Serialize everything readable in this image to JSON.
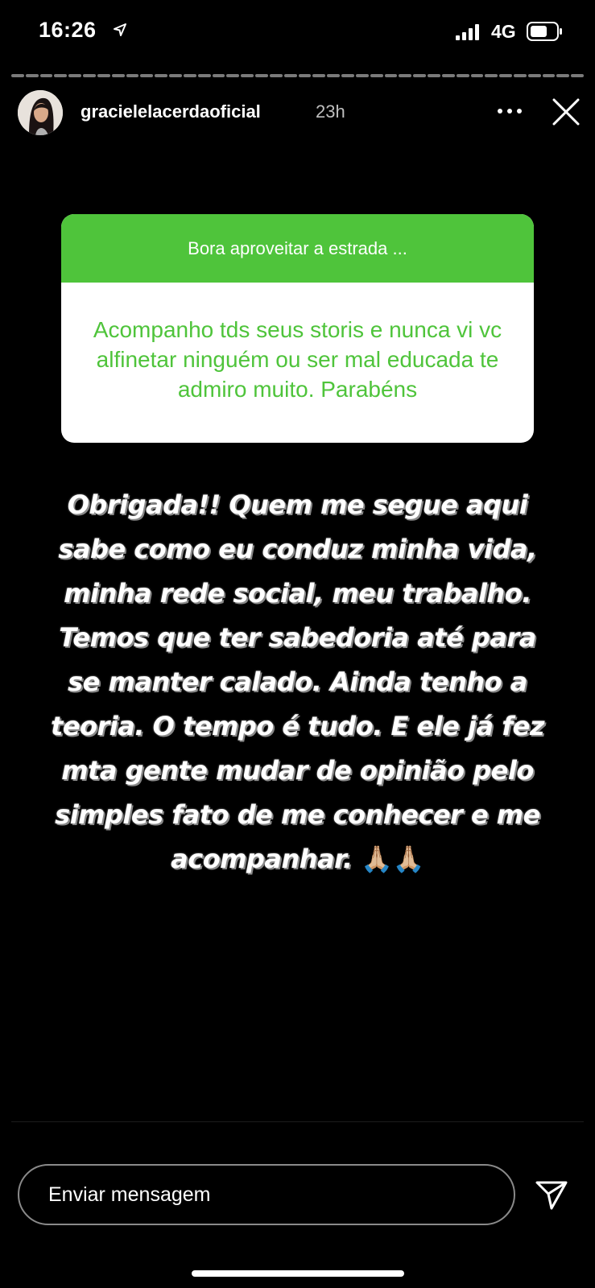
{
  "status_bar": {
    "time": "16:26",
    "network": "4G",
    "icons": [
      "location-arrow-icon",
      "cellular-signal-icon",
      "battery-icon"
    ]
  },
  "story": {
    "username": "gracielelacerdaoficial",
    "time_ago": "23h",
    "progress_segments": 40
  },
  "question_sticker": {
    "prompt": "Bora aproveitar a estrada ...",
    "answer": "Acompanho tds seus storis e nunca vi vc alfinetar  ninguém   ou ser mal educada te admiro muito. Parabéns",
    "colors": {
      "header": "#4fc43b",
      "answer_text": "#4fc43b"
    }
  },
  "reply": {
    "text": "Obrigada!! Quem me segue aqui sabe como eu conduz minha vida, minha rede social, meu trabalho. Temos que ter sabedoria até para se manter calado. Ainda tenho a teoria. O tempo é tudo. E ele já fez mta gente mudar de opinião pelo simples fato de me conhecer e me acompanhar.",
    "emoji": "🙏🏼🙏🏼"
  },
  "composer": {
    "placeholder": "Enviar mensagem",
    "send_icon": "send-paper-plane-icon"
  }
}
